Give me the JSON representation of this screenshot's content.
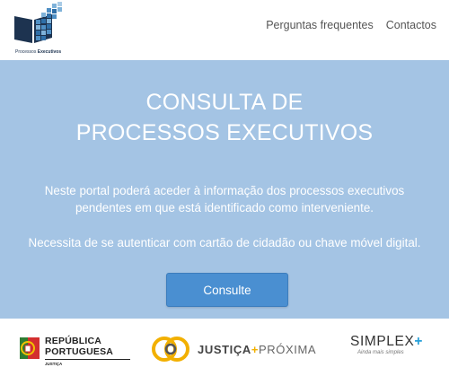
{
  "header": {
    "logo_text_regular": "Processos",
    "logo_text_bold": "Executivos",
    "nav": [
      "Perguntas frequentes",
      "Contactos"
    ]
  },
  "hero": {
    "title_line1": "CONSULTA DE",
    "title_line2": "PROCESSOS EXECUTIVOS",
    "text1": "Neste portal poderá aceder à informação dos processos executivos pendentes em que está identificado como interveniente.",
    "text2": "Necessita de se autenticar com cartão de cidadão ou chave móvel digital.",
    "button_label": "Consulte"
  },
  "footer": {
    "republica_line1": "REPÚBLICA",
    "republica_line2": "PORTUGUESA",
    "republica_sub": "JUSTIÇA",
    "justica_bold": "JUSTIÇA",
    "justica_plus": "+",
    "justica_rest": "PRÓXIMA",
    "simplex_text": "SIMPLEX",
    "simplex_plus": "+",
    "simplex_sub": "Ainda mais simples"
  },
  "colors": {
    "hero_bg": "#a4c4e4",
    "button_bg": "#4a8fd1",
    "accent_yellow": "#f2b000",
    "simplex_blue": "#27a0d9"
  }
}
